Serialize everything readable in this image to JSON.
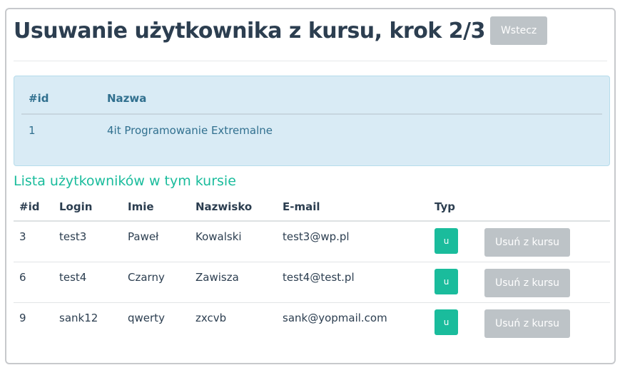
{
  "page": {
    "title": "Usuwanie użytkownika z kursu, krok 2/3",
    "back_label": "Wstecz"
  },
  "course": {
    "headers": {
      "id": "#id",
      "name": "Nazwa"
    },
    "row": {
      "id": "1",
      "name": "4it Programowanie Extremalne"
    }
  },
  "users": {
    "section_title": "Lista użytkowników w tym kursie",
    "headers": {
      "id": "#id",
      "login": "Login",
      "first_name": "Imie",
      "last_name": "Nazwisko",
      "email": "E-mail",
      "type": "Typ"
    },
    "rows": [
      {
        "id": "3",
        "login": "test3",
        "first_name": "Paweł",
        "last_name": "Kowalski",
        "email": "test3@wp.pl",
        "type": "u",
        "action": "Usuń z kursu"
      },
      {
        "id": "6",
        "login": "test4",
        "first_name": "Czarny",
        "last_name": "Zawisza",
        "email": "test4@test.pl",
        "type": "u",
        "action": "Usuń z kursu"
      },
      {
        "id": "9",
        "login": "sank12",
        "first_name": "qwerty",
        "last_name": "zxcvb",
        "email": "sank@yopmail.com",
        "type": "u",
        "action": "Usuń z kursu"
      }
    ]
  },
  "colors": {
    "heading": "#2c3e50",
    "accent": "#1abc9c",
    "info_bg": "#d9ebf5",
    "info_text": "#31708f",
    "button_gray": "#bdc3c7"
  }
}
